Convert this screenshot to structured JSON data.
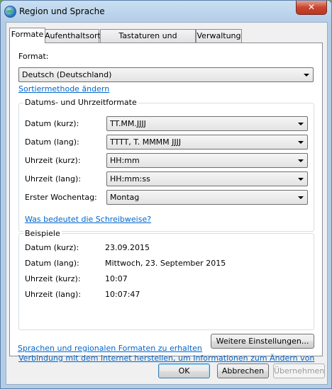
{
  "window": {
    "title": "Region und Sprache",
    "close_glyph": "✕"
  },
  "tabs": [
    {
      "label": "Formate",
      "active": true
    },
    {
      "label": "Aufenthaltsort",
      "active": false
    },
    {
      "label": "Tastaturen und Sprachen",
      "active": false
    },
    {
      "label": "Verwaltung",
      "active": false
    }
  ],
  "format": {
    "label": "Format:",
    "value": "Deutsch (Deutschland)",
    "sort_link": "Sortiermethode ändern"
  },
  "datetime_group": {
    "title": "Datums- und Uhrzeitformate",
    "fields": [
      {
        "label": "Datum (kurz):",
        "value": "TT.MM.JJJJ"
      },
      {
        "label": "Datum (lang):",
        "value": "TTTT, T. MMMM JJJJ"
      },
      {
        "label": "Uhrzeit (kurz):",
        "value": "HH:mm"
      },
      {
        "label": "Uhrzeit (lang):",
        "value": "HH:mm:ss"
      },
      {
        "label": "Erster Wochentag:",
        "value": "Montag"
      }
    ],
    "notation_link": "Was bedeutet die Schreibweise?"
  },
  "examples": {
    "title": "Beispiele",
    "rows": [
      {
        "label": "Datum (kurz):",
        "value": "23.09.2015"
      },
      {
        "label": "Datum (lang):",
        "value": "Mittwoch, 23. September 2015"
      },
      {
        "label": "Uhrzeit (kurz):",
        "value": "10:07"
      },
      {
        "label": "Uhrzeit (lang):",
        "value": "10:07:47"
      }
    ]
  },
  "more_settings_button": "Weitere Einstellungen...",
  "internet_link": {
    "line1": "Verbindung mit dem Internet herstellen, um Informationen zum Ändern von",
    "line2": "Sprachen und regionalen Formaten zu erhalten"
  },
  "buttons": {
    "ok": "OK",
    "cancel": "Abbrechen",
    "apply": "Übernehmen"
  }
}
